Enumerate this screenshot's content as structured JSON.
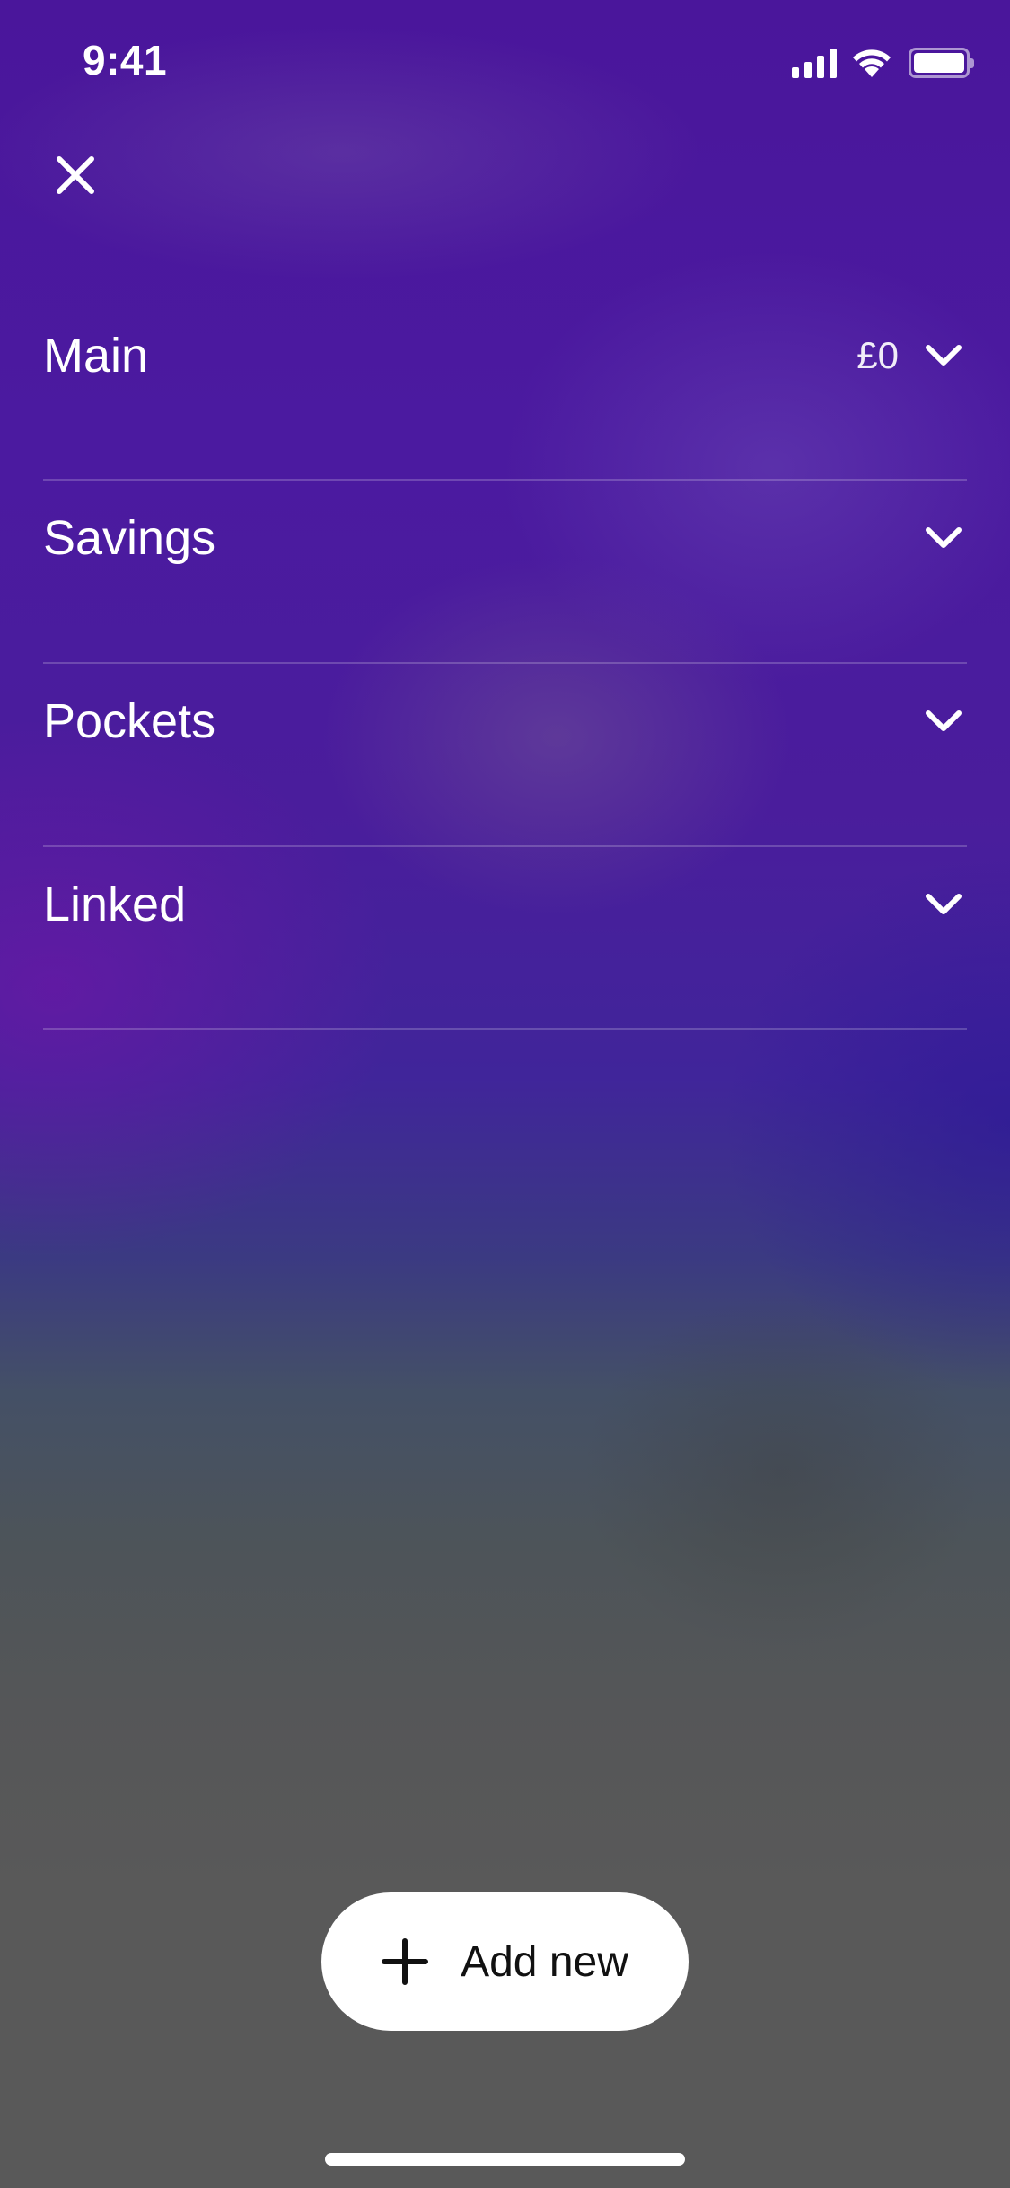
{
  "status_bar": {
    "time": "9:41",
    "icons": [
      "cellular-signal-icon",
      "wifi-icon",
      "battery-icon"
    ]
  },
  "header": {
    "close_icon": "close-icon"
  },
  "accounts": [
    {
      "name": "Main",
      "amount": "£0",
      "icon": "chevron-down-icon"
    },
    {
      "name": "Savings",
      "amount": "",
      "icon": "chevron-down-icon"
    },
    {
      "name": "Pockets",
      "amount": "",
      "icon": "chevron-down-icon"
    },
    {
      "name": "Linked",
      "amount": "",
      "icon": "chevron-down-icon"
    }
  ],
  "add_button": {
    "label": "Add new",
    "icon": "plus-icon"
  },
  "colors": {
    "background_top": "#4a169b",
    "background_bottom": "#595959",
    "button_bg": "#ffffff",
    "button_text": "#111111",
    "text": "#ffffff"
  }
}
